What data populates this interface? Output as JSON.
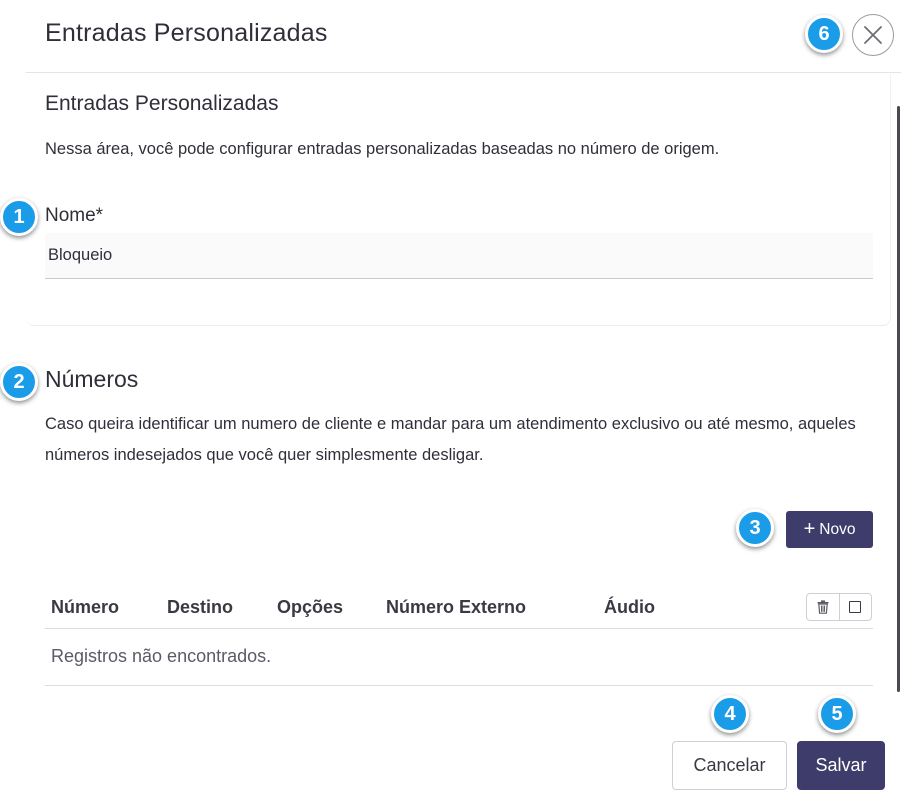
{
  "modal": {
    "title": "Entradas Personalizadas",
    "close_icon": "close-x-icon"
  },
  "custom_entry": {
    "section_title": "Entradas Personalizadas",
    "description": "Nessa área, você pode configurar entradas personalizadas baseadas no número de origem.",
    "name_label": "Nome*",
    "name_value": "Bloqueio"
  },
  "numbers": {
    "title": "Números",
    "description": "Caso queira identificar um numero de cliente e mandar para um atendimento exclusivo ou até mesmo, aqueles números indesejados que você quer simplesmente desligar.",
    "new_button_label": "Novo",
    "new_button_icon": "plus-icon",
    "table": {
      "columns": [
        "Número",
        "Destino",
        "Opções",
        "Número Externo",
        "Áudio"
      ],
      "header_action_icons": [
        "trash-icon",
        "checkbox-icon"
      ],
      "empty_message": "Registros não encontrados."
    }
  },
  "footer": {
    "cancel_label": "Cancelar",
    "save_label": "Salvar"
  },
  "callouts": [
    "1",
    "2",
    "3",
    "4",
    "5",
    "6"
  ],
  "colors": {
    "primary": "#3e3c6b",
    "callout": "#1a9ce8",
    "text": "#2f2f3a",
    "border": "#dcdce2"
  }
}
